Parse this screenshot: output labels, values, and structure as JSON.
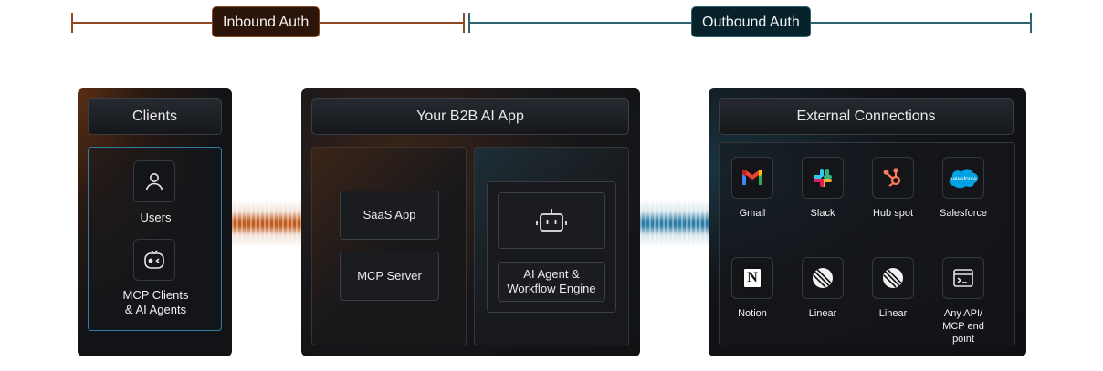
{
  "auth_ranges": {
    "inbound_label": "Inbound Auth",
    "outbound_label": "Outbound Auth"
  },
  "clients_panel": {
    "title": "Clients",
    "users_label": "Users",
    "mcp_clients_label_line1": "MCP Clients",
    "mcp_clients_label_line2": "& AI Agents"
  },
  "app_panel": {
    "title": "Your B2B AI App",
    "saas_app_label": "SaaS App",
    "mcp_server_label": "MCP Server",
    "agent_label_line1": "AI Agent &",
    "agent_label_line2": "Workflow Engine"
  },
  "external_panel": {
    "title": "External Connections",
    "connections": [
      {
        "name": "Gmail",
        "icon": "gmail-icon"
      },
      {
        "name": "Slack",
        "icon": "slack-icon"
      },
      {
        "name": "Hub spot",
        "icon": "hubspot-icon"
      },
      {
        "name": "Salesforce",
        "icon": "salesforce-icon",
        "logo_text": "salesforce"
      },
      {
        "name": "Notion",
        "icon": "notion-icon",
        "logo_text": "N"
      },
      {
        "name": "Linear",
        "icon": "linear-icon"
      },
      {
        "name": "Linear",
        "icon": "linear-icon"
      },
      {
        "name_line1": "Any API/",
        "name_line2": "MCP end",
        "name_line3": "point",
        "icon": "terminal-icon"
      }
    ]
  },
  "colors": {
    "inbound_accent": "#8b4a22",
    "outbound_accent": "#2e6470",
    "inbound_flow": "#c25c1f",
    "outbound_flow": "#2f7fa8",
    "panel_background": "#121316"
  }
}
